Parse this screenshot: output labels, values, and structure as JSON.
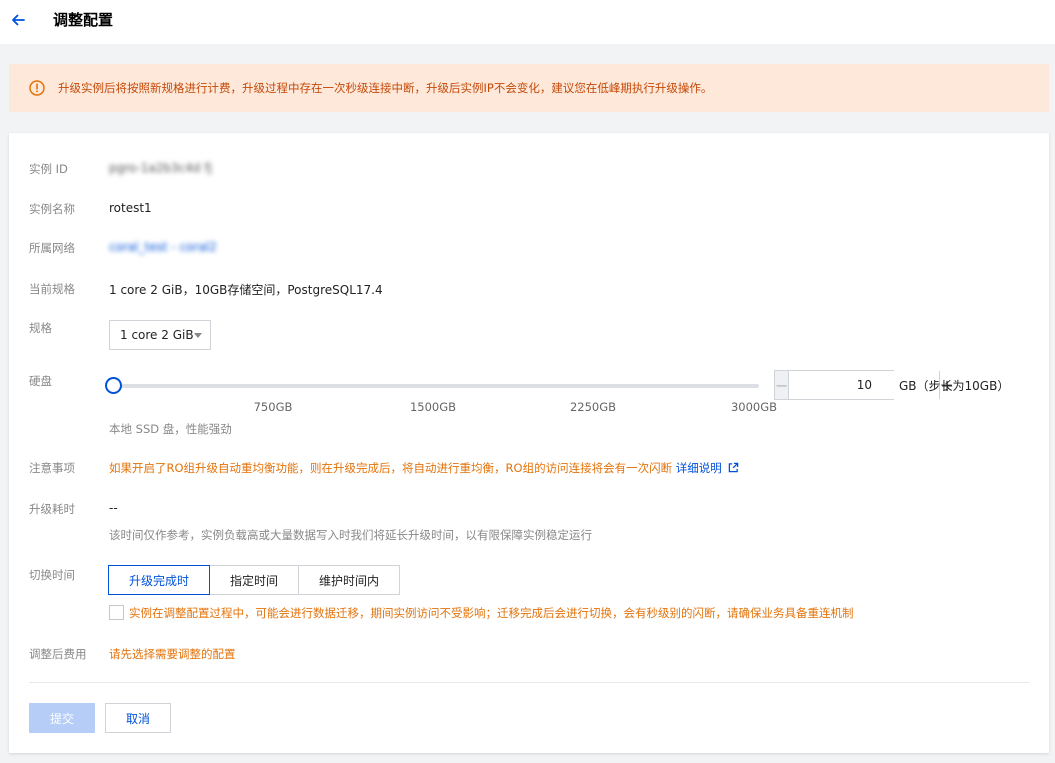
{
  "header": {
    "title": "调整配置"
  },
  "notice": {
    "text": "升级实例后将按照新规格进行计费，升级过程中存在一次秒级连接中断，升级后实例IP不会变化，建议您在低峰期执行升级操作。"
  },
  "form": {
    "instance_id": {
      "label": "实例 ID",
      "value": "pgro-1a2b3c4d fj"
    },
    "instance_name": {
      "label": "实例名称",
      "value": "rotest1"
    },
    "network": {
      "label": "所属网络",
      "value": "coral_test - coral2"
    },
    "current_spec": {
      "label": "当前规格",
      "value": "1 core 2 GiB，10GB存储空间，PostgreSQL17.4"
    },
    "spec": {
      "label": "规格",
      "selected": "1 core 2 GiB"
    },
    "disk": {
      "label": "硬盘",
      "ticks": [
        "750GB",
        "1500GB",
        "2250GB",
        "3000GB"
      ],
      "value": "10",
      "unit": "GB（步长为10GB）",
      "hint": "本地 SSD 盘，性能强劲",
      "slider_min": 10,
      "slider_max": 3000,
      "slider_value": 10
    },
    "notes": {
      "label": "注意事项",
      "text": "如果开启了RO组升级自动重均衡功能，则在升级完成后，将自动进行重均衡，RO组的访问连接将会有一次闪断",
      "link": "详细说明"
    },
    "upgrade_time": {
      "label": "升级耗时",
      "value": "--",
      "hint": "该时间仅作参考，实例负载高或大量数据写入时我们将延长升级时间，以有限保障实例稳定运行"
    },
    "switch_time": {
      "label": "切换时间",
      "tabs": [
        "升级完成时",
        "指定时间",
        "维护时间内"
      ],
      "active_tab": 0,
      "checkbox_text": "实例在调整配置过程中，可能会进行数据迁移，期间实例访问不受影响；迁移完成后会进行切换，会有秒级别的闪断，请确保业务具备重连机制"
    },
    "cost": {
      "label": "调整后费用",
      "value": "请先选择需要调整的配置"
    }
  },
  "actions": {
    "submit": "提交",
    "cancel": "取消"
  },
  "colors": {
    "accent": "#0052d9",
    "warning": "#e3730b",
    "notice_bg": "#fde8d9"
  }
}
